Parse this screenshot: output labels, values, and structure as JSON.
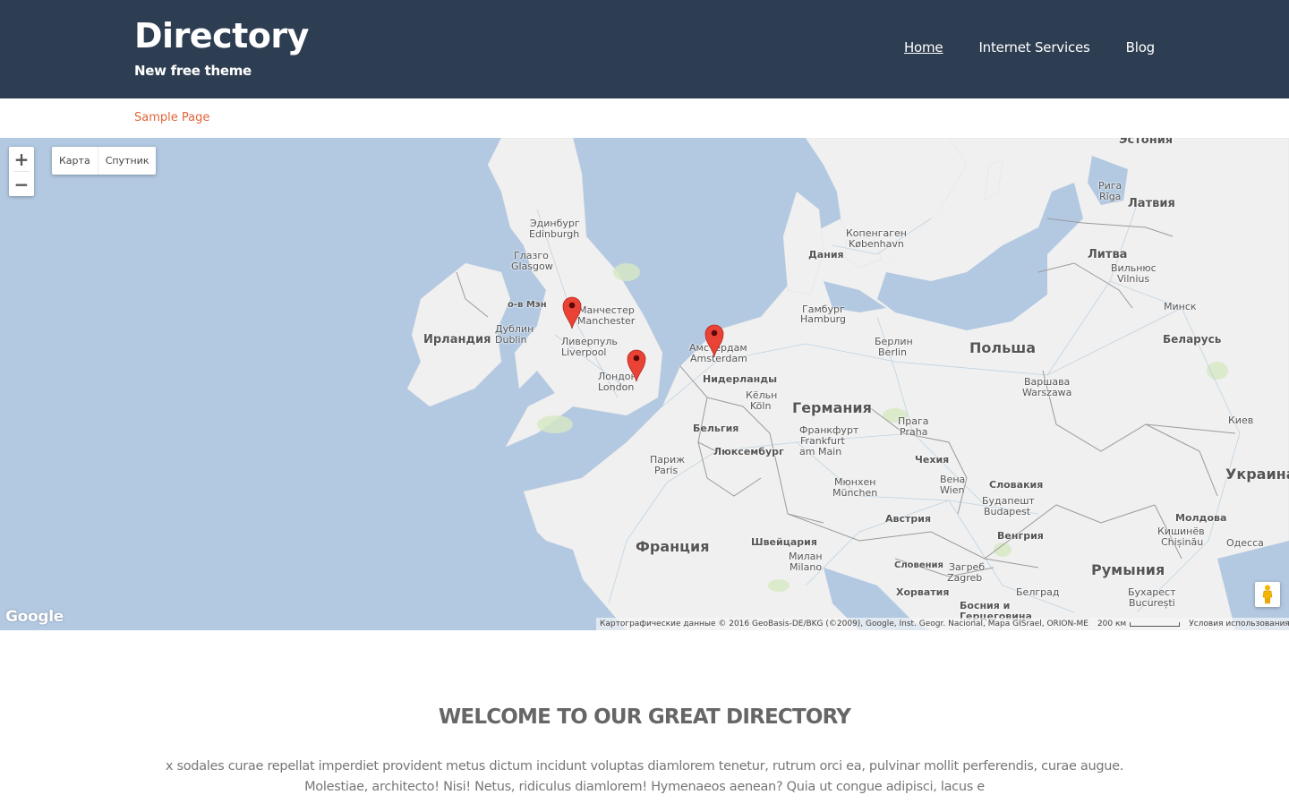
{
  "header": {
    "site_title": "Directory",
    "tagline": "New free theme",
    "nav": [
      {
        "label": "Home",
        "active": true
      },
      {
        "label": "Internet Services",
        "active": false
      },
      {
        "label": "Blog",
        "active": false
      }
    ]
  },
  "subnav": {
    "link": "Sample Page"
  },
  "map": {
    "zoom_in": "+",
    "zoom_out": "−",
    "map_types": [
      "Карта",
      "Спутник"
    ],
    "logo": "Google",
    "attribution": "Картографические данные © 2016 GeoBasis-DE/BKG (©2009), Google, Inst. Geogr. Nacional, Mapa GISrael, ORION-ME",
    "scale_label": "200 км",
    "terms": "Условия использования",
    "markers": [
      "Manchester",
      "London",
      "Amsterdam"
    ],
    "labels": {
      "estonia": "Эстония",
      "riga_ru": "Рига",
      "riga": "Rīga",
      "latvia": "Латвия",
      "edinburgh_ru": "Эдинбург",
      "edinburgh": "Edinburgh",
      "glasgow_ru": "Глазго",
      "glasgow": "Glasgow",
      "copenhagen_ru": "Копенгаген",
      "copenhagen": "København",
      "denmark": "Дания",
      "lithuania": "Литва",
      "vilnius_ru": "Вильнюс",
      "vilnius": "Vilnius",
      "isle_of_man": "о-в Мэн",
      "manchester_ru": "Манчестер",
      "manchester": "Manchester",
      "hamburg_ru": "Гамбург",
      "hamburg": "Hamburg",
      "minsk": "Минск",
      "ireland": "Ирландия",
      "dublin_ru": "Дублин",
      "dublin": "Dublin",
      "liverpool_ru": "Ливерпуль",
      "liverpool": "Liverpool",
      "amsterdam_ru": "Амстердам",
      "amsterdam": "Amsterdam",
      "berlin_ru": "Берлин",
      "berlin": "Berlin",
      "poland": "Польша",
      "belarus": "Беларусь",
      "london_ru": "Лондон",
      "london": "London",
      "netherlands": "Нидерланды",
      "warsaw_ru": "Варшава",
      "warsaw": "Warszawa",
      "cologne_ru": "Кёльн",
      "cologne": "Köln",
      "germany": "Германия",
      "prague_ru": "Прага",
      "prague": "Praha",
      "kiev": "Киев",
      "belgium": "Бельгия",
      "frankfurt_ru": "Франкфурт",
      "frankfurt": "Frankfurt",
      "frankfurt2": "am Main",
      "luxembourg": "Люксембург",
      "czechia": "Чехия",
      "paris_ru": "Париж",
      "paris": "Paris",
      "vienna_ru": "Вена",
      "vienna": "Wien",
      "slovakia": "Словакия",
      "ukraine": "Украина",
      "munich_ru": "Мюнхен",
      "munich": "München",
      "budapest_ru": "Будапешт",
      "budapest": "Budapest",
      "austria": "Австрия",
      "moldova": "Молдова",
      "chisinau_ru": "Кишинёв",
      "chisinau": "Chișinău",
      "hungary": "Венгрия",
      "france": "Франция",
      "switzerland": "Швейцария",
      "odessa": "Одесса",
      "milan_ru": "Милан",
      "milan": "Milano",
      "slovenia": "Словения",
      "zagreb_ru": "Загреб",
      "zagreb": "Zagreb",
      "romania": "Румыния",
      "croatia": "Хорватия",
      "belgrade": "Белград",
      "bucharest_ru": "Бухарест",
      "bucharest": "București",
      "bosnia": "Босния и",
      "bosnia2": "Герцеговина"
    }
  },
  "welcome": {
    "title": "WELCOME TO OUR GREAT DIRECTORY",
    "text": "x sodales curae repellat imperdiet provident metus dictum incidunt voluptas diamlorem tenetur, rutrum orci ea, pulvinar mollit perferendis, curae augue. Molestiae, architecto! Nisi! Netus, ridiculus diamlorem! Hymenaeos aenean? Quia ut congue adipisci, lacus e"
  },
  "colors": {
    "header_bg": "#2e3e52",
    "accent": "#e0643a",
    "water": "#b3c9e2",
    "land": "#f0f0f0",
    "marker": "#ea4335"
  }
}
